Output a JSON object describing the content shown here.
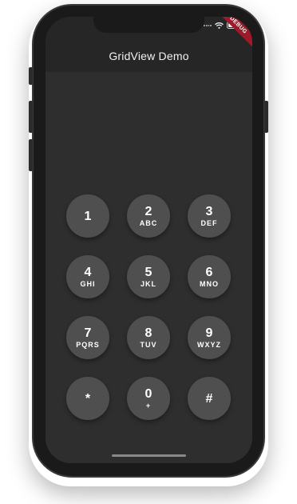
{
  "app": {
    "title": "GridView Demo",
    "debug_label": "DEBUG"
  },
  "status_bar": {
    "icons": [
      "signal-dots-icon",
      "wifi-icon",
      "battery-icon"
    ]
  },
  "keypad": {
    "keys": [
      {
        "digit": "1",
        "letters": ""
      },
      {
        "digit": "2",
        "letters": "ABC"
      },
      {
        "digit": "3",
        "letters": "DEF"
      },
      {
        "digit": "4",
        "letters": "GHI"
      },
      {
        "digit": "5",
        "letters": "JKL"
      },
      {
        "digit": "6",
        "letters": "MNO"
      },
      {
        "digit": "7",
        "letters": "PQRS"
      },
      {
        "digit": "8",
        "letters": "TUV"
      },
      {
        "digit": "9",
        "letters": "WXYZ"
      },
      {
        "digit": "*",
        "letters": ""
      },
      {
        "digit": "0",
        "letters": "+"
      },
      {
        "digit": "#",
        "letters": ""
      }
    ]
  },
  "colors": {
    "screen_bg": "#2e2e2e",
    "appbar_bg": "#262626",
    "key_bg": "#4f4f4f",
    "key_text": "#ffffff",
    "debug_banner": "#9c1a2a"
  }
}
